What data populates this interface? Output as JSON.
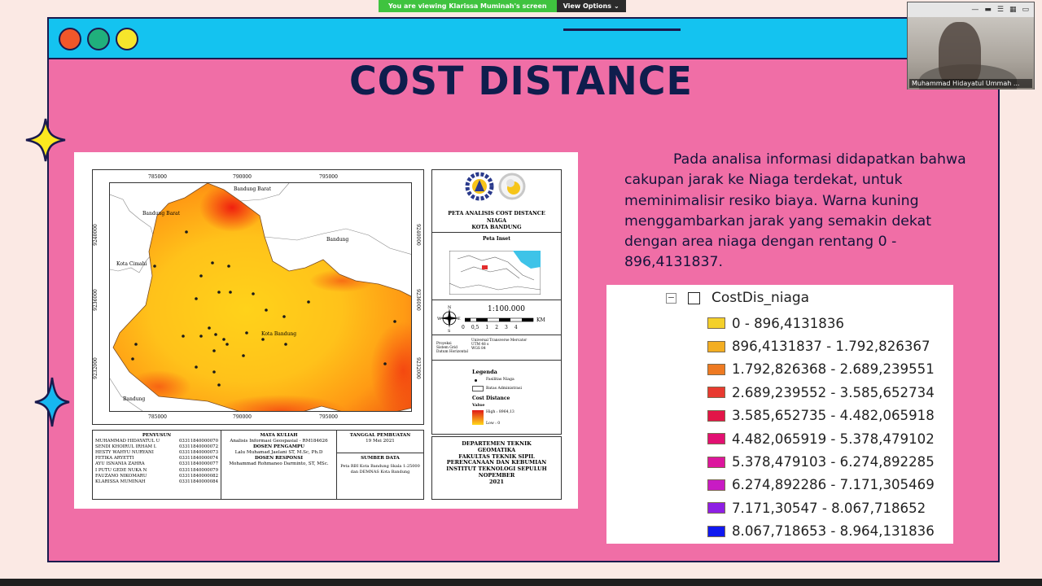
{
  "zoom": {
    "banner_text": "You are viewing Klarissa Muminah's screen",
    "view_options_label": "View Options",
    "participant_name": "Muhammad Hidayatul Ummah ..."
  },
  "slide": {
    "title": "COST DISTANCE",
    "description": "Pada analisa informasi didapatkan bahwa cakupan jarak ke Niaga terdekat, untuk meminimalisir resiko biaya. Warna kuning menggambarkan jarak yang semakin dekat dengan area niaga dengan rentang 0 - 896,4131837."
  },
  "map": {
    "x_ticks": [
      "785000",
      "790000",
      "795000"
    ],
    "y_ticks": [
      "9240000",
      "9236000",
      "9232000"
    ],
    "places": {
      "bandung_barat_1": "Bandung Barat",
      "bandung_barat_2": "Bandung Barat",
      "bandung": "Bandung",
      "kota_cimahi": "Kota Cimahi",
      "kota_bandung": "Kota Bandung",
      "bandung_south": "Bandung"
    },
    "title_block": {
      "title_line1": "PETA ANALISIS COST DISTANCE",
      "title_line2": "NIAGA",
      "title_line3": "KOTA BANDUNG",
      "inset_title": "Peta Inset",
      "scale": "1:100.000",
      "scale_ticks": [
        "0",
        "0,5",
        "1",
        "2",
        "3",
        "4"
      ],
      "scale_unit": "KM",
      "compass": [
        "N",
        "S",
        "W",
        "E"
      ],
      "proj_labels": [
        "Proyeksi",
        "Sistem Grid",
        "Datum Horizontal"
      ],
      "proj_values": [
        "Universal Transverse Mercator",
        "UTM 48 s",
        "WGS 84"
      ],
      "legend_title": "Legenda",
      "legend_fasilitas": "Fasilitas Niaga",
      "legend_batas": "Batas Administrasi",
      "legend_cost": "Cost Distance",
      "legend_value": "Value",
      "legend_high": "High : 8964,13",
      "legend_low": "Low : 0",
      "dept": [
        "DEPARTEMEN TEKNIK",
        "GEOMATIKA",
        "FAKULTAS TEKNIK SIPIL",
        "PERENCANAAN DAN KEBUMIAN",
        "INSTITUT TEKNOLOGI SEPULUH",
        "NOPEMBER",
        "2021"
      ]
    },
    "penyusun_title": "PENYUSUN",
    "penyusun": [
      {
        "name": "MUHAMMAD HIDAYATUL U",
        "nrp": "03311840000070"
      },
      {
        "name": "SENDI KHOIRUL IRHAM I.",
        "nrp": "03311840000072"
      },
      {
        "name": "HESTY WAHYU NURYANI",
        "nrp": "03311840000073"
      },
      {
        "name": "FETIKA ARYETTI",
        "nrp": "03311840000074"
      },
      {
        "name": "AYU ISNANIA ZAHRA",
        "nrp": "03311840000077"
      },
      {
        "name": "I PUTU GEDE NUKA N",
        "nrp": "03311840000079"
      },
      {
        "name": "FAUZANO NIKOMARU",
        "nrp": "03311840000082"
      },
      {
        "name": "KLARISSA MUMINAH",
        "nrp": "03311840000084"
      }
    ],
    "mata_kuliah_title": "MATA KULIAH",
    "mata_kuliah": "Analisis Informasi Geospasial - RM184626",
    "dosen_pengampu_title": "DOSEN PENGAMPU",
    "dosen_pengampu": "Lalu Muhamad Jaelani ST, M.Sc, Ph.D",
    "dosen_responsi_title": "DOSEN RESPONSI",
    "dosen_responsi": "Mohammad Rohmaneo Darminto, ST, MSc.",
    "tanggal_title": "TANGGAL PEMBUATAN",
    "tanggal": "19 Mei 2021",
    "sumber_title": "SUMBER DATA",
    "sumber": "Peta RBI Kota Bandung Skala 1:25000 dan DEMNAS Kota Bandung"
  },
  "legend": {
    "title": "CostDis_niaga",
    "items": [
      {
        "label": "0 - 896,4131836",
        "color": "#f4d02a"
      },
      {
        "label": "896,4131837 - 1.792,826367",
        "color": "#f3ae22"
      },
      {
        "label": "1.792,826368 - 2.689,239551",
        "color": "#ee7a22"
      },
      {
        "label": "2.689,239552 - 3.585,652734",
        "color": "#e83a30"
      },
      {
        "label": "3.585,652735 - 4.482,065918",
        "color": "#e21548"
      },
      {
        "label": "4.482,065919 - 5.378,479102",
        "color": "#e21072"
      },
      {
        "label": "5.378,479103 - 6.274,892285",
        "color": "#dc169d"
      },
      {
        "label": "6.274,892286 - 7.171,305469",
        "color": "#c81bc4"
      },
      {
        "label": "7.171,30547 - 8.067,718652",
        "color": "#8e1fe4"
      },
      {
        "label": "8.067,718653 - 8.964,131836",
        "color": "#1019f0"
      }
    ]
  }
}
